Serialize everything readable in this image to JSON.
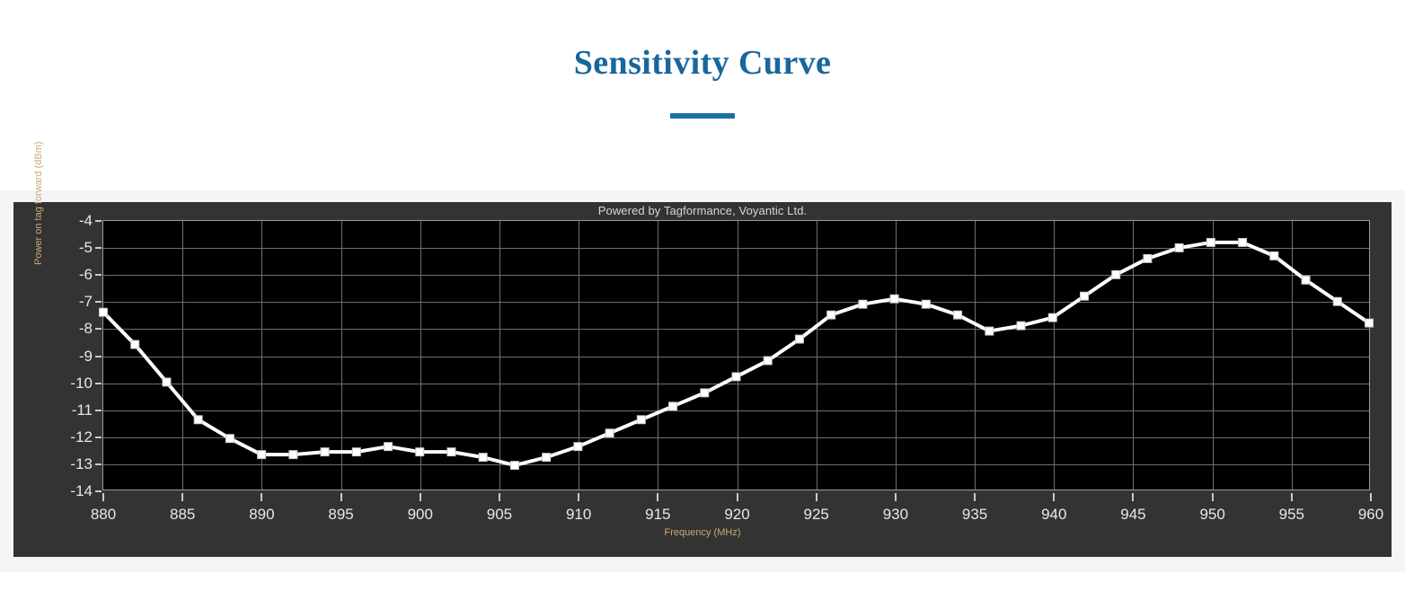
{
  "header": {
    "title": "Sensitivity Curve"
  },
  "chart_panel": {
    "watermark": "Powered by Tagformance, Voyantic Ltd.",
    "background_color": "#333333",
    "plot_background_color": "#000000",
    "series_color": "#ffffff",
    "axis_label_color": "#cfa87a",
    "tick_label_color": "#e8e8e8",
    "grid_color": "#6f6f6f"
  },
  "chart_data": {
    "type": "line",
    "title": "Sensitivity Curve",
    "subtitle": "Powered by Tagformance, Voyantic Ltd.",
    "xlabel": "Frequency (MHz)",
    "ylabel": "Power on tag forward (dBm)",
    "xlim": [
      880,
      960
    ],
    "ylim": [
      -14,
      -4
    ],
    "xticks": [
      880,
      885,
      890,
      895,
      900,
      905,
      910,
      915,
      920,
      925,
      930,
      935,
      940,
      945,
      950,
      955,
      960
    ],
    "yticks": [
      -4,
      -5,
      -6,
      -7,
      -8,
      -9,
      -10,
      -11,
      -12,
      -13,
      -14
    ],
    "grid": true,
    "legend": "none",
    "markers": "square",
    "x": [
      880,
      882,
      884,
      886,
      888,
      890,
      892,
      894,
      896,
      898,
      900,
      902,
      904,
      906,
      908,
      910,
      912,
      914,
      916,
      918,
      920,
      922,
      924,
      926,
      928,
      930,
      932,
      934,
      936,
      938,
      940,
      942,
      944,
      946,
      948,
      950,
      952,
      954,
      956,
      958,
      960
    ],
    "y": [
      -7.4,
      -8.6,
      -10.0,
      -11.4,
      -12.1,
      -12.7,
      -12.7,
      -12.6,
      -12.6,
      -12.4,
      -12.6,
      -12.6,
      -12.8,
      -13.1,
      -12.8,
      -12.4,
      -11.9,
      -11.4,
      -10.9,
      -10.4,
      -9.8,
      -9.2,
      -8.4,
      -7.5,
      -7.1,
      -6.9,
      -7.1,
      -7.5,
      -8.1,
      -7.9,
      -7.6,
      -6.8,
      -6.0,
      -5.4,
      -5.0,
      -4.8,
      -4.8,
      -5.3,
      -6.2,
      -7.0,
      -7.8
    ],
    "series": [
      {
        "name": "Power on tag forward (dBm)",
        "values": [
          -7.4,
          -8.6,
          -10.0,
          -11.4,
          -12.1,
          -12.7,
          -12.7,
          -12.6,
          -12.6,
          -12.4,
          -12.6,
          -12.6,
          -12.8,
          -13.1,
          -12.8,
          -12.4,
          -11.9,
          -11.4,
          -10.9,
          -10.4,
          -9.8,
          -9.2,
          -8.4,
          -7.5,
          -7.1,
          -6.9,
          -7.1,
          -7.5,
          -8.1,
          -7.9,
          -7.6,
          -6.8,
          -6.0,
          -5.4,
          -5.0,
          -4.8,
          -4.8,
          -5.3,
          -6.2,
          -7.0,
          -7.8
        ]
      }
    ]
  }
}
